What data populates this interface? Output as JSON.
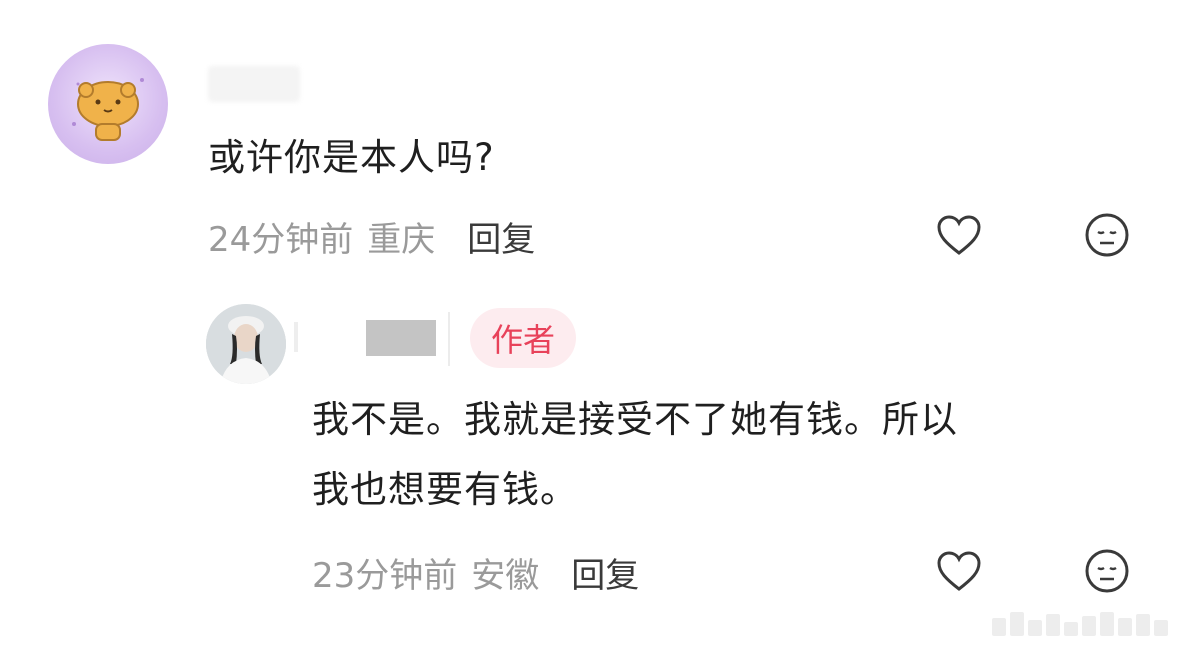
{
  "comments": [
    {
      "text": "或许你是本人吗?",
      "time": "24分钟前",
      "location": "重庆",
      "reply_label": "回复"
    }
  ],
  "reply": {
    "badge": "作者",
    "text_line1": "我不是。我就是接受不了她有钱。所以",
    "text_line2": "我也想要有钱。",
    "time": "23分钟前",
    "location": "安徽",
    "reply_label": "回复"
  },
  "colors": {
    "badge_text": "#e8425a",
    "badge_bg": "#fdecef",
    "meta": "#9a9a9a",
    "text": "#1f1f1f"
  },
  "icons": [
    "heart-outline-icon",
    "meh-face-icon"
  ]
}
